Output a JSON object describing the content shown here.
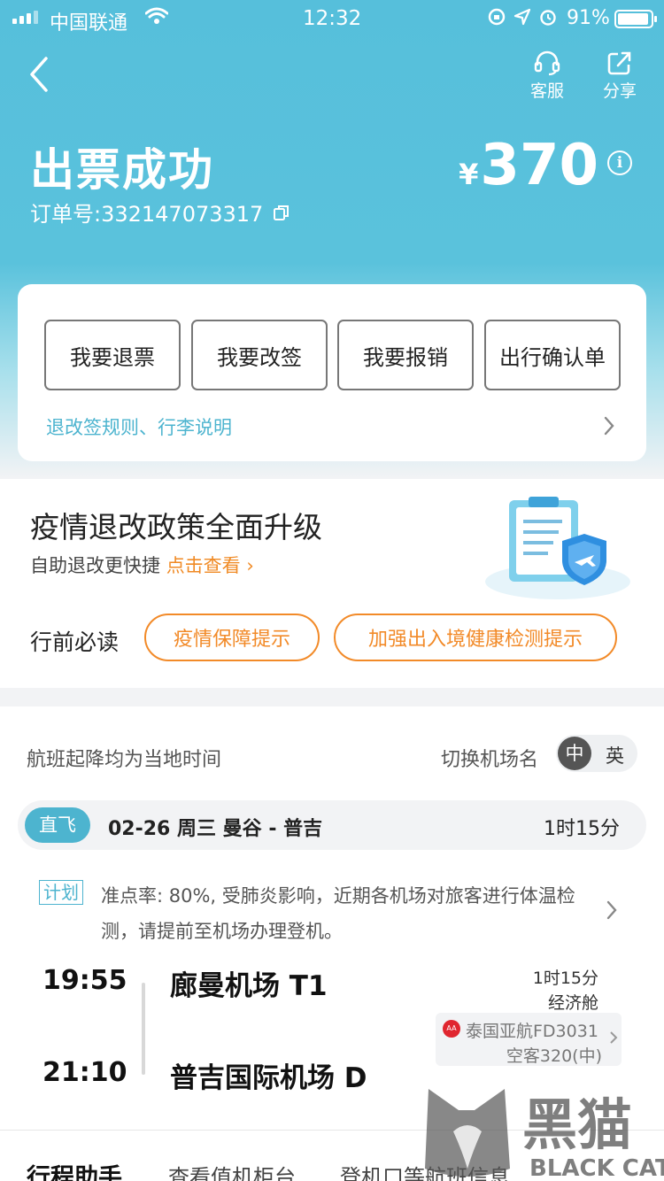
{
  "status_bar": {
    "carrier": "中国联通",
    "time": "12:32",
    "battery_pct": "91%"
  },
  "header": {
    "service_label": "客服",
    "share_label": "分享"
  },
  "ticket": {
    "title": "出票成功",
    "order_no": "订单号:332147073317",
    "currency": "¥",
    "price": "370"
  },
  "actions": {
    "buttons": [
      "我要退票",
      "我要改签",
      "我要报销",
      "出行确认单"
    ],
    "rules_link": "退改签规则、行李说明"
  },
  "policy": {
    "title": "疫情退改政策全面升级",
    "subtitle": "自助退改更快捷",
    "link": "点击查看",
    "must_read_label": "行前必读",
    "tips": [
      "疫情保障提示",
      "加强出入境健康检测提示"
    ]
  },
  "flight": {
    "local_time_note": "航班起降均为当地时间",
    "switch_label": "切换机场名",
    "lang_on": "中",
    "lang_off": "英",
    "direct_tag": "直飞",
    "route_summary": "02-26 周三 曼谷 - 普吉",
    "duration": "1时15分",
    "plan_tag": "计划",
    "plan_text": "准点率: 80%, 受肺炎影响，近期各机场对旅客进行体温检测，请提前至机场办理登机。",
    "dep_time": "19:55",
    "dep_airport": "廊曼机场 T1",
    "arr_time": "21:10",
    "arr_airport": "普吉国际机场 D",
    "cabin": "经济舱",
    "airline": "泰国亚航FD3031",
    "aircraft": "空客320(中)",
    "airline_logo_text": "AirAsia"
  },
  "assistant": {
    "title": "行程助手",
    "links": [
      "查看值机柜台",
      "登机口等航班信息"
    ]
  },
  "watermark": {
    "cn": "黑猫",
    "en": "BLACK CAT"
  },
  "colors": {
    "accent": "#4db4cf",
    "orange": "#f28a28",
    "hero": "#56bfdb"
  }
}
